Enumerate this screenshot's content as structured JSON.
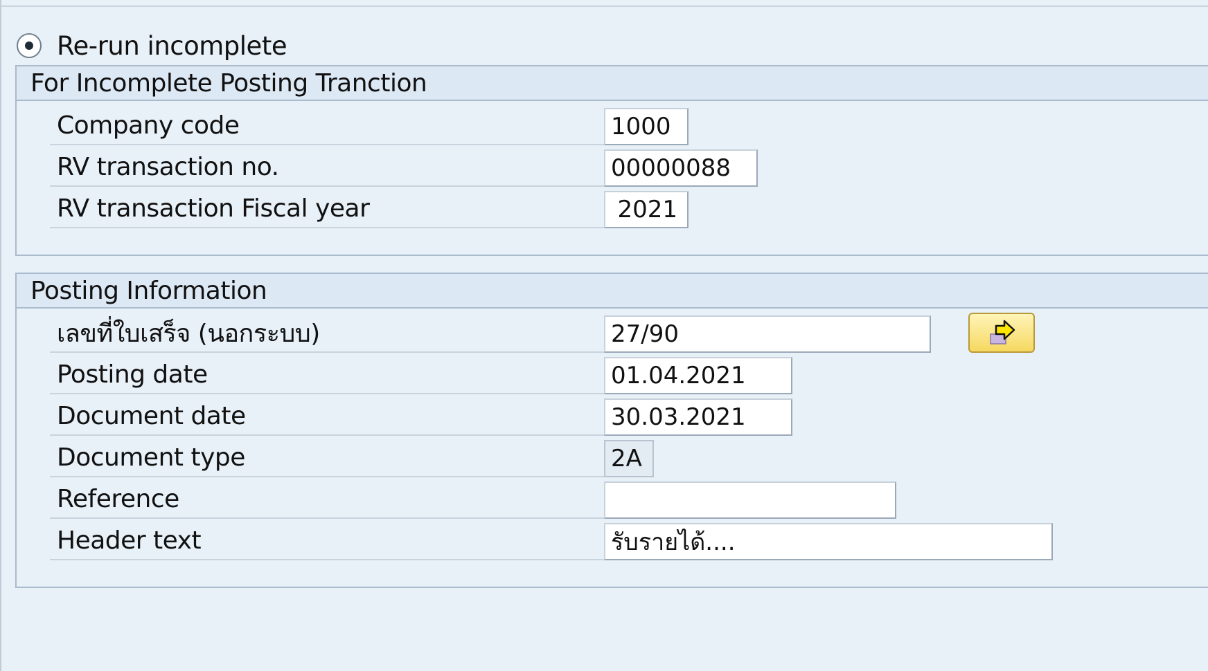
{
  "radio": {
    "label": "Re-run incomplete",
    "selected": true
  },
  "group1": {
    "title": "For Incomplete Posting Tranction",
    "fields": [
      {
        "label": "Company code",
        "value": "1000"
      },
      {
        "label": "RV transaction no.",
        "value": "00000088"
      },
      {
        "label": "RV transaction Fiscal year",
        "value": "2021"
      }
    ]
  },
  "group2": {
    "title": "Posting Information",
    "fields": [
      {
        "label": "เลขที่ใบเสร็จ (นอกระบบ)",
        "value": "27/90"
      },
      {
        "label": "Posting date",
        "value": "01.04.2021"
      },
      {
        "label": "Document date",
        "value": "30.03.2021"
      },
      {
        "label": "Document type",
        "value": "2A"
      },
      {
        "label": "Reference",
        "value": ""
      },
      {
        "label": "Header text",
        "value": "รับรายได้...."
      }
    ],
    "nav_button_icon": "arrow-right-icon"
  },
  "colors": {
    "background": "#e8f0f8",
    "group_header": "#dce8f4",
    "button_yellow": "#f6d860"
  }
}
